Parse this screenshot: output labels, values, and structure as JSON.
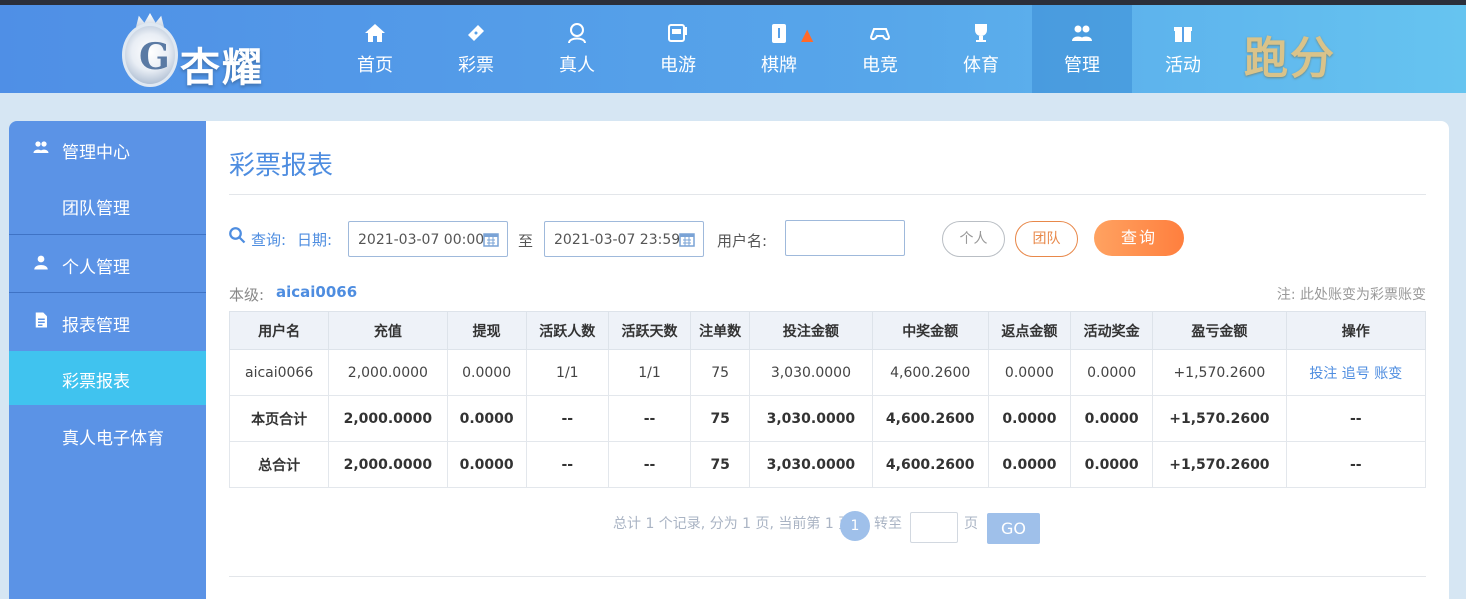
{
  "brand": {
    "name": "杏耀",
    "promo_text": "跑分"
  },
  "nav": [
    {
      "label": "首页",
      "icon": "home-icon"
    },
    {
      "label": "彩票",
      "icon": "ticket-icon"
    },
    {
      "label": "真人",
      "icon": "dealer-icon"
    },
    {
      "label": "电游",
      "icon": "slot-machine-icon"
    },
    {
      "label": "棋牌",
      "icon": "mahjong-icon",
      "hot": true
    },
    {
      "label": "电竞",
      "icon": "gamepad-icon"
    },
    {
      "label": "体育",
      "icon": "trophy-icon"
    },
    {
      "label": "管理",
      "icon": "users-icon",
      "active": true
    },
    {
      "label": "活动",
      "icon": "gift-icon"
    }
  ],
  "sidebar": {
    "items": [
      {
        "label": "管理中心",
        "icon": "users-icon",
        "type": "section"
      },
      {
        "label": "团队管理",
        "type": "sub"
      },
      {
        "label": "个人管理",
        "icon": "user-icon",
        "type": "section"
      },
      {
        "label": "报表管理",
        "icon": "report-icon",
        "type": "section"
      },
      {
        "label": "彩票报表",
        "type": "sub",
        "active": true
      },
      {
        "label": "真人电子体育",
        "type": "sub"
      }
    ]
  },
  "page": {
    "title": "彩票报表"
  },
  "filters": {
    "query_label": "查询:",
    "date_label": "日期:",
    "start_date": "2021-03-07 00:00",
    "to_label": "至",
    "end_date": "2021-03-07 23:59",
    "username_label": "用户名:",
    "username_value": "",
    "personal_btn": "个人",
    "team_btn": "团队",
    "search_btn": "查询"
  },
  "level": {
    "label": "本级:",
    "value": "aicai0066"
  },
  "note": "注: 此处账变为彩票账变",
  "table": {
    "headers": [
      "用户名",
      "充值",
      "提现",
      "活跃人数",
      "活跃天数",
      "注单数",
      "投注金额",
      "中奖金额",
      "返点金额",
      "活动奖金",
      "盈亏金额",
      "操作"
    ],
    "row": {
      "username": "aicai0066",
      "recharge": "2,000.0000",
      "withdraw": "0.0000",
      "active_users": "1/1",
      "active_days": "1/1",
      "orders": "75",
      "bet_amount": "3,030.0000",
      "win_amount": "4,600.2600",
      "rebate": "0.0000",
      "bonus": "0.0000",
      "profit": "+1,570.2600",
      "actions": [
        "投注",
        "追号",
        "账变"
      ]
    },
    "page_total": {
      "label": "本页合计",
      "recharge": "2,000.0000",
      "withdraw": "0.0000",
      "active_users": "--",
      "active_days": "--",
      "orders": "75",
      "bet_amount": "3,030.0000",
      "win_amount": "4,600.2600",
      "rebate": "0.0000",
      "bonus": "0.0000",
      "profit": "+1,570.2600",
      "op": "--"
    },
    "grand_total": {
      "label": "总合计",
      "recharge": "2,000.0000",
      "withdraw": "0.0000",
      "active_users": "--",
      "active_days": "--",
      "orders": "75",
      "bet_amount": "3,030.0000",
      "win_amount": "4,600.2600",
      "rebate": "0.0000",
      "bonus": "0.0000",
      "profit": "+1,570.2600",
      "op": "--"
    }
  },
  "pager": {
    "summary": "总计 1 个记录, 分为 1 页, 当前第 1 页",
    "current": "1",
    "goto_label": "转至",
    "page_unit": "页",
    "go_btn": "GO"
  },
  "colors": {
    "accent": "#4e8de0",
    "profit": "#1e8b2e",
    "search": "#ff8f4a",
    "sidebar": "#5b93e6",
    "sidebar_active": "#40c3ef"
  }
}
